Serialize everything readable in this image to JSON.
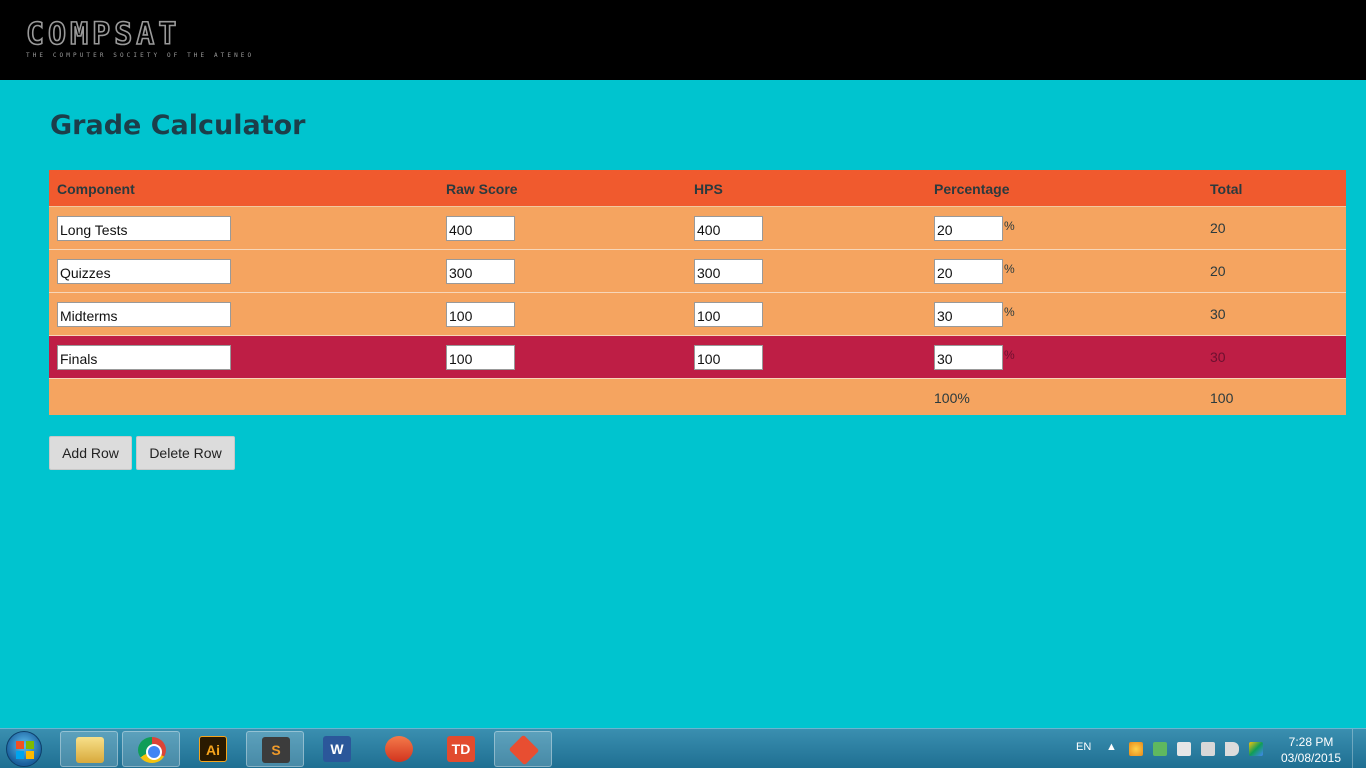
{
  "header": {
    "logo_text": "COMPSAT",
    "logo_subtitle": "THE COMPUTER SOCIETY OF THE ATENEO"
  },
  "page": {
    "title": "Grade Calculator"
  },
  "table": {
    "columns": [
      "Component",
      "Raw Score",
      "HPS",
      "Percentage",
      "Total"
    ],
    "rows": [
      {
        "component": "Long Tests",
        "raw_score": "400",
        "hps": "400",
        "percentage": "20",
        "total": "20"
      },
      {
        "component": "Quizzes",
        "raw_score": "300",
        "hps": "300",
        "percentage": "20",
        "total": "20"
      },
      {
        "component": "Midterms",
        "raw_score": "100",
        "hps": "100",
        "percentage": "30",
        "total": "30"
      },
      {
        "component": "Finals",
        "raw_score": "100",
        "hps": "100",
        "percentage": "30",
        "total": "30"
      }
    ],
    "percent_sign": "%",
    "footer": {
      "percentage_total": "100%",
      "grand_total": "100"
    }
  },
  "buttons": {
    "add_row": "Add Row",
    "delete_row": "Delete Row"
  },
  "taskbar": {
    "apps": [
      "windows-explorer",
      "chrome",
      "illustrator",
      "sublime-text",
      "word",
      "app-circle",
      "todoist",
      "git"
    ],
    "icon_labels": {
      "ai": "Ai",
      "sublime": "S",
      "word": "W",
      "td": "TD"
    },
    "language": "EN",
    "tray_arrow": "▲",
    "time": "7:28 PM",
    "date": "03/08/2015"
  },
  "colors": {
    "background": "#00c4cf",
    "header_row": "#f05a2e",
    "data_row": "#f5a460",
    "selected_row": "#be1e45",
    "title": "#1c3e4a"
  }
}
